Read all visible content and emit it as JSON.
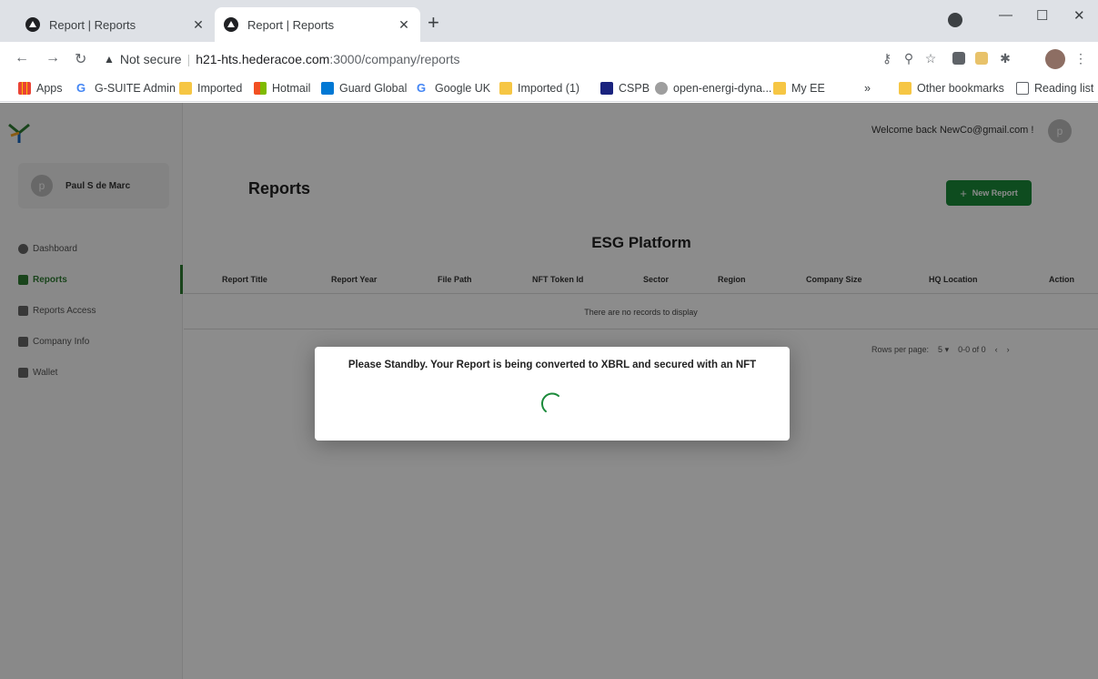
{
  "browser": {
    "tabs": [
      {
        "title": "Report | Reports",
        "active": false
      },
      {
        "title": "Report | Reports",
        "active": true
      }
    ],
    "url": {
      "security_label": "Not secure",
      "host": "h21-hts.hederacoe.com",
      "path": ":3000/company/reports"
    },
    "bookmarks": [
      "Apps",
      "G-SUITE Admin",
      "Imported",
      "Hotmail",
      "Guard Global",
      "Google UK",
      "Imported (1)",
      "CSPB",
      "open-energi-dyna...",
      "My EE"
    ],
    "other_bookmarks": "Other bookmarks",
    "reading_list": "Reading list",
    "overflow": "»"
  },
  "sidebar": {
    "user_initial": "p",
    "user_name": "Paul S de Marc",
    "items": [
      {
        "label": "Dashboard",
        "icon": "pie-chart-icon"
      },
      {
        "label": "Reports",
        "icon": "document-icon"
      },
      {
        "label": "Reports Access",
        "icon": "checkbox-icon"
      },
      {
        "label": "Company Info",
        "icon": "briefcase-icon"
      },
      {
        "label": "Wallet",
        "icon": "lock-icon"
      }
    ]
  },
  "header": {
    "welcome": "Welcome back NewCo@gmail.com !",
    "avatar_initial": "p"
  },
  "main": {
    "title": "Reports",
    "new_report_label": "New Report",
    "platform_title": "ESG Platform",
    "columns": [
      "Report Title",
      "Report Year",
      "File Path",
      "NFT Token Id",
      "Sector",
      "Region",
      "Company Size",
      "HQ Location",
      "Action"
    ],
    "empty_message": "There are no records to display",
    "pager": {
      "rows_label": "Rows per page:",
      "rows_value": "5",
      "range": "0-0 of 0"
    }
  },
  "modal": {
    "message": "Please Standby. Your Report is being converted to XBRL and secured with an NFT"
  },
  "colors": {
    "accent": "#1b8a3a",
    "overlay": "rgba(0,0,0,0.45)"
  }
}
